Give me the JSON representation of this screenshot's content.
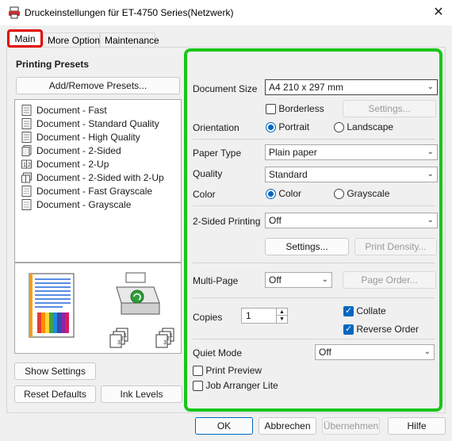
{
  "window": {
    "title": "Druckeinstellungen für ET-4750 Series(Netzwerk)",
    "close_glyph": "✕"
  },
  "tabs": [
    {
      "label": "Main",
      "selected": true
    },
    {
      "label": "More Options",
      "selected": false
    },
    {
      "label": "Maintenance",
      "selected": false
    }
  ],
  "presets": {
    "title": "Printing Presets",
    "add_remove_label": "Add/Remove Presets...",
    "items": [
      {
        "label": "Document - Fast",
        "icon": "document-icon"
      },
      {
        "label": "Document - Standard Quality",
        "icon": "document-icon"
      },
      {
        "label": "Document - High Quality",
        "icon": "document-icon"
      },
      {
        "label": "Document - 2-Sided",
        "icon": "two-sided-icon"
      },
      {
        "label": "Document - 2-Up",
        "icon": "two-up-icon"
      },
      {
        "label": "Document - 2-Sided with 2-Up",
        "icon": "two-sided-two-up-icon"
      },
      {
        "label": "Document - Fast Grayscale",
        "icon": "grayscale-document-icon"
      },
      {
        "label": "Document - Grayscale",
        "icon": "grayscale-document-icon"
      }
    ]
  },
  "left_buttons": {
    "show_settings": "Show Settings",
    "reset_defaults": "Reset Defaults",
    "ink_levels": "Ink Levels"
  },
  "preview": {
    "page_numbers": [
      "1",
      "2",
      "3"
    ]
  },
  "settings": {
    "document_size": {
      "label": "Document Size",
      "value": "A4 210 x 297 mm"
    },
    "borderless": {
      "label": "Borderless",
      "checked": false
    },
    "borderless_settings": "Settings...",
    "orientation": {
      "label": "Orientation",
      "options": [
        "Portrait",
        "Landscape"
      ],
      "selected": "Portrait"
    },
    "paper_type": {
      "label": "Paper Type",
      "value": "Plain paper"
    },
    "quality": {
      "label": "Quality",
      "value": "Standard"
    },
    "color": {
      "label": "Color",
      "options": [
        "Color",
        "Grayscale"
      ],
      "selected": "Color"
    },
    "two_sided": {
      "label": "2-Sided Printing",
      "value": "Off"
    },
    "two_sided_settings": "Settings...",
    "print_density": "Print Density...",
    "multi_page": {
      "label": "Multi-Page",
      "value": "Off"
    },
    "page_order": "Page Order...",
    "copies": {
      "label": "Copies",
      "value": "1"
    },
    "collate": {
      "label": "Collate",
      "checked": true
    },
    "reverse_order": {
      "label": "Reverse Order",
      "checked": true
    },
    "quiet_mode": {
      "label": "Quiet Mode",
      "value": "Off"
    },
    "print_preview": {
      "label": "Print Preview",
      "checked": false
    },
    "job_arranger": {
      "label": "Job Arranger Lite",
      "checked": false
    }
  },
  "footer": {
    "ok": "OK",
    "cancel": "Abbrechen",
    "apply": "Übernehmen",
    "help": "Hilfe"
  },
  "colors": {
    "highlight_box": "#19c619",
    "tab_highlight": "#e00000",
    "accent": "#0067c0"
  }
}
